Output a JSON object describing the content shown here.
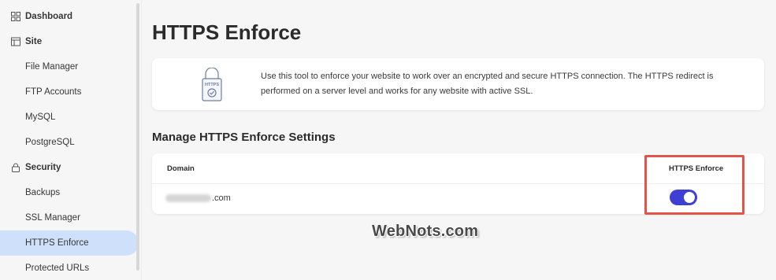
{
  "sidebar": {
    "items": [
      {
        "label": "Dashboard",
        "type": "section",
        "icon": "dashboard-grid-icon"
      },
      {
        "label": "Site",
        "type": "section",
        "icon": "site-window-icon"
      },
      {
        "label": "File Manager",
        "type": "sub"
      },
      {
        "label": "FTP Accounts",
        "type": "sub"
      },
      {
        "label": "MySQL",
        "type": "sub"
      },
      {
        "label": "PostgreSQL",
        "type": "sub"
      },
      {
        "label": "Security",
        "type": "section",
        "icon": "lock-icon"
      },
      {
        "label": "Backups",
        "type": "sub"
      },
      {
        "label": "SSL Manager",
        "type": "sub"
      },
      {
        "label": "HTTPS Enforce",
        "type": "sub",
        "active": true
      },
      {
        "label": "Protected URLs",
        "type": "sub"
      }
    ]
  },
  "main": {
    "title": "HTTPS Enforce",
    "info": {
      "icon_label": "HTTPS",
      "text": "Use this tool to enforce your website to work over an encrypted and secure HTTPS connection. The HTTPS redirect is performed on a server level and works for any website with active SSL."
    },
    "settings": {
      "title": "Manage HTTPS Enforce Settings",
      "columns": {
        "domain": "Domain",
        "enforce": "HTTPS Enforce"
      },
      "rows": [
        {
          "domain_suffix": ".com",
          "enforce_on": true
        }
      ]
    }
  },
  "watermark": "WebNots.com",
  "colors": {
    "accent": "#3f3fd6",
    "active_bg": "#cfe0fb",
    "highlight": "#e2534a"
  }
}
